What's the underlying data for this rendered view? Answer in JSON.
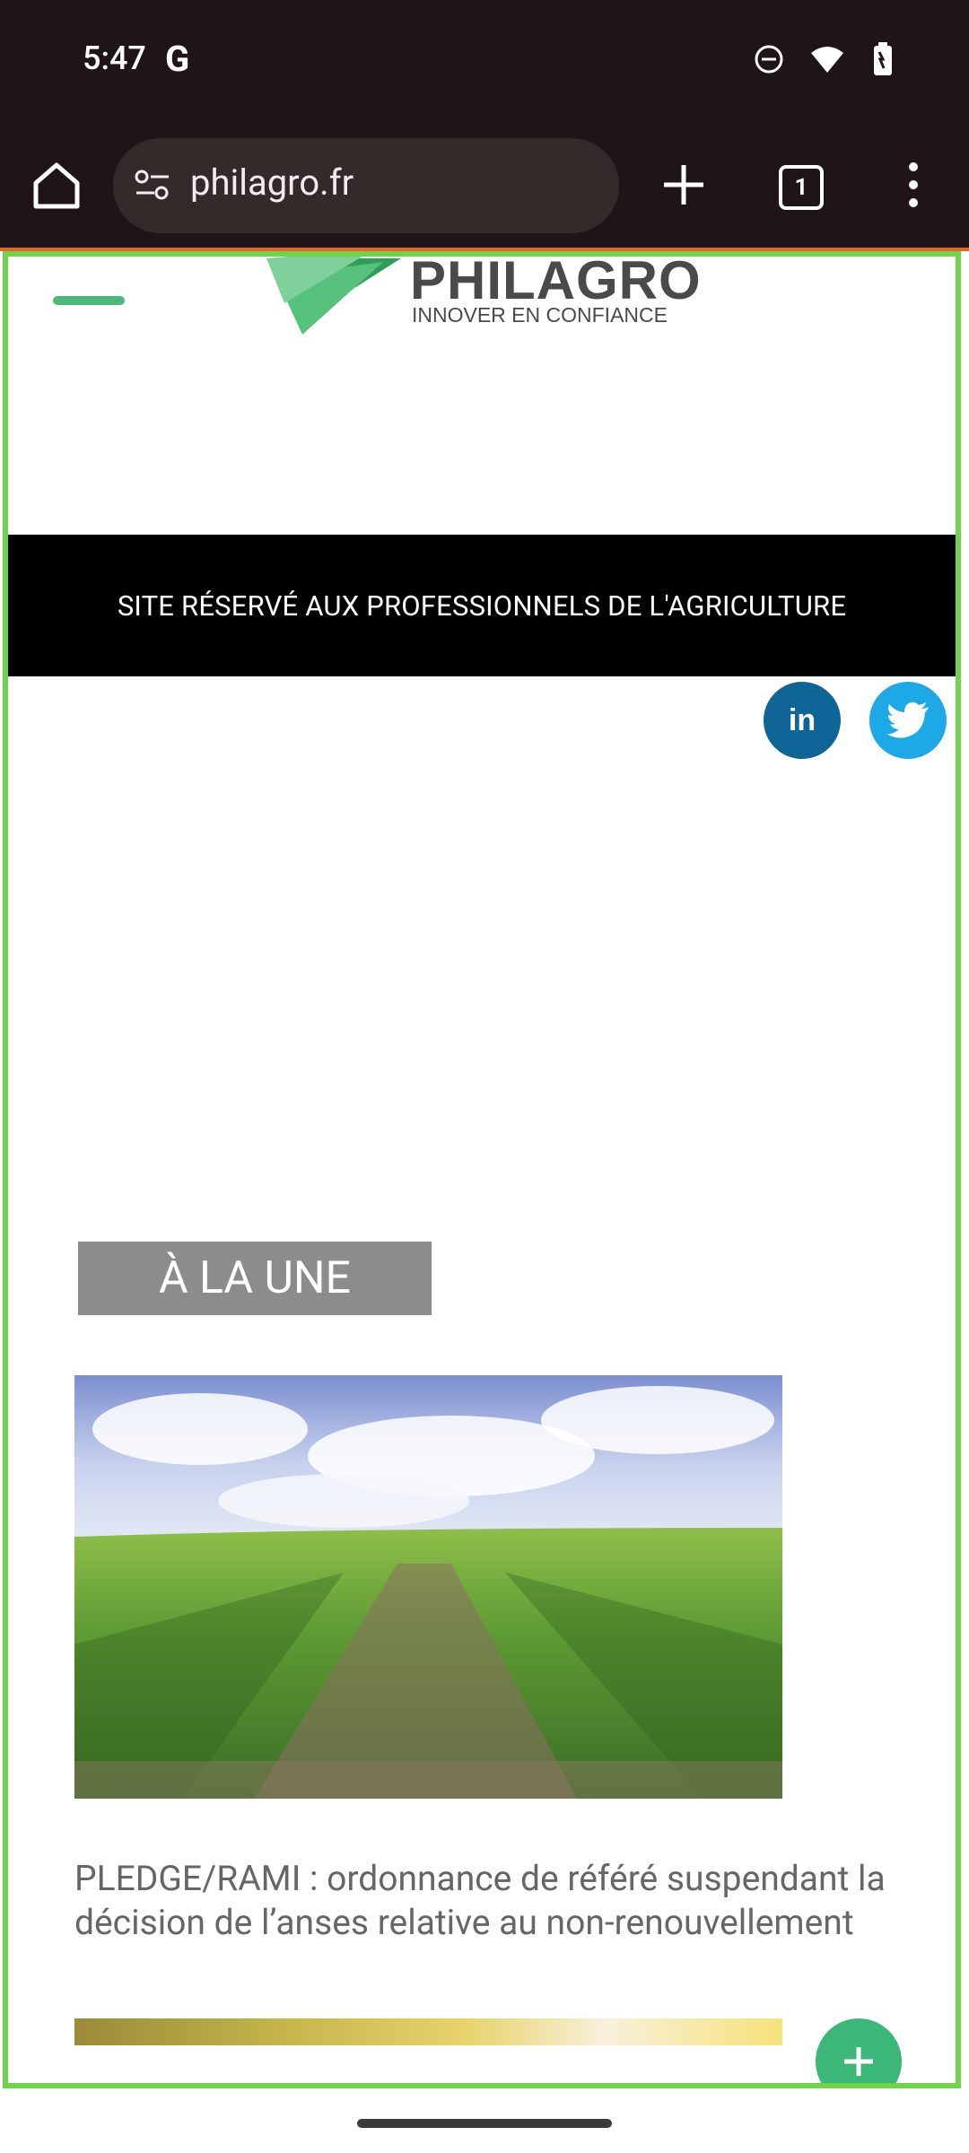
{
  "status_bar": {
    "time": "5:47",
    "google_label": "G",
    "icons": [
      "do-not-disturb-icon",
      "wifi-icon",
      "battery-icon"
    ]
  },
  "browser": {
    "url": "philagro.fr",
    "tab_count": "1",
    "icons": [
      "home-icon",
      "site-settings-icon",
      "new-tab-icon",
      "tabs-icon",
      "menu-icon"
    ]
  },
  "site": {
    "logo_name": "PHILAGRO",
    "logo_tagline": "INNOVER EN CONFIANCE",
    "banner_text": "SITE RÉSERVÉ AUX PROFESSIONNELS DE L'AGRICULTURE",
    "social": {
      "linkedin_label": "in"
    },
    "section_label": "À LA UNE",
    "article_title": "PLEDGE/RAMI : ordonnance de référé suspendant la décision de l’anses relative au non-renouvellement"
  },
  "colors": {
    "status_bar_bg": "#1f1416",
    "frame_border": "#6fd44a",
    "brand_green": "#4db87a",
    "banner_bg": "#000000",
    "linkedin": "#0e6596",
    "twitter": "#1da8e6",
    "section_label_bg": "#8c8c8c",
    "fab": "#3bb77a"
  }
}
